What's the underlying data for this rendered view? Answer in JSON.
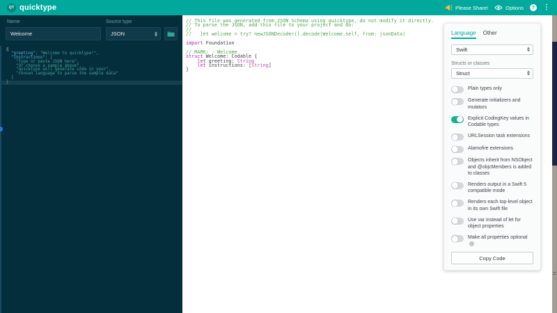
{
  "colors": {
    "header_bar": "#00a99c",
    "left_panel_bg": "#052e3d",
    "accent_teal": "#00a99c",
    "toggle_on": "#10b397",
    "comment_green": "#4ca64c",
    "keyword_magenta": "#ad28a2",
    "json_key_blue": "#58b0d4",
    "json_string_teal": "#45a491"
  },
  "header": {
    "logo_text": "QT",
    "app_name": "quicktype",
    "share_label": "Please Share!",
    "options_label": "Options",
    "help_label": "?",
    "menu_icon": "vertical-dots"
  },
  "left_panel": {
    "name_label": "Name",
    "name_value": "Welcome",
    "source_type_label": "Source type",
    "source_type_value": "JSON",
    "json_lines": [
      {
        "segs": [
          {
            "c": "jp hl",
            "t": "{"
          }
        ]
      },
      {
        "segs": [
          {
            "c": "jp",
            "t": "  "
          },
          {
            "c": "jk",
            "t": "\"greeting\""
          },
          {
            "c": "jp",
            "t": ": "
          },
          {
            "c": "js",
            "t": "\"Welcome to quicktype!\""
          },
          {
            "c": "jp",
            "t": ","
          }
        ]
      },
      {
        "segs": [
          {
            "c": "jp",
            "t": "  "
          },
          {
            "c": "jk",
            "t": "\"instructions\""
          },
          {
            "c": "jp",
            "t": ": ["
          }
        ]
      },
      {
        "segs": [
          {
            "c": "jp",
            "t": "    "
          },
          {
            "c": "js",
            "t": "\"Type or paste JSON here\""
          },
          {
            "c": "jp",
            "t": ","
          }
        ]
      },
      {
        "segs": [
          {
            "c": "jp",
            "t": "    "
          },
          {
            "c": "js",
            "t": "\"Or choose a sample above\""
          },
          {
            "c": "jp",
            "t": ","
          }
        ]
      },
      {
        "segs": [
          {
            "c": "jp",
            "t": "    "
          },
          {
            "c": "js",
            "t": "\"quicktype will generate code in your\""
          },
          {
            "c": "jp",
            "t": ","
          }
        ]
      },
      {
        "segs": [
          {
            "c": "jp",
            "t": "    "
          },
          {
            "c": "js",
            "t": "\"chosen language to parse the sample data\""
          }
        ]
      },
      {
        "segs": [
          {
            "c": "jp",
            "t": "  ]"
          }
        ]
      },
      {
        "segs": [
          {
            "c": "jp",
            "t": "}"
          }
        ],
        "active": true
      }
    ]
  },
  "code_editor": {
    "language": "Swift",
    "lines": [
      {
        "segs": [
          {
            "c": "cm",
            "t": "// This file was generated from JSON Schema using quicktype, do not modify it directly."
          }
        ]
      },
      {
        "segs": [
          {
            "c": "cm",
            "t": "// To parse the JSON, add this file to your project and do:"
          }
        ]
      },
      {
        "segs": [
          {
            "c": "cm",
            "t": "//"
          }
        ]
      },
      {
        "segs": [
          {
            "c": "cm",
            "t": "//   let welcome = try? newJSONDecoder().decode(Welcome.self, from: jsonData)"
          }
        ]
      },
      {
        "segs": []
      },
      {
        "segs": [
          {
            "c": "kw",
            "t": "import"
          },
          {
            "c": "pl",
            "t": " Foundation"
          }
        ]
      },
      {
        "segs": []
      },
      {
        "segs": [
          {
            "c": "cm",
            "t": "// MARK: - Welcome"
          }
        ]
      },
      {
        "segs": [
          {
            "c": "kw",
            "t": "struct"
          },
          {
            "c": "pl",
            "t": " Welcome: Codable {"
          }
        ]
      },
      {
        "segs": [
          {
            "c": "pl",
            "t": "    "
          },
          {
            "c": "kw",
            "t": "let"
          },
          {
            "c": "pl",
            "t": " greeting: "
          },
          {
            "c": "ty",
            "t": "String"
          }
        ]
      },
      {
        "segs": [
          {
            "c": "pl",
            "t": "    "
          },
          {
            "c": "kw",
            "t": "let"
          },
          {
            "c": "pl",
            "t": " instructions: ["
          },
          {
            "c": "ty",
            "t": "String"
          },
          {
            "c": "pl",
            "t": "]"
          }
        ]
      },
      {
        "segs": [
          {
            "c": "pl",
            "t": "}"
          }
        ]
      }
    ]
  },
  "options_panel": {
    "tabs": [
      {
        "label": "Language",
        "active": true
      },
      {
        "label": "Other",
        "active": false
      }
    ],
    "language_value": "Swift",
    "structs_label": "Structs or classes",
    "structs_value": "Struct",
    "toggles": [
      {
        "label": "Plain types only",
        "on": false
      },
      {
        "label": "Generate initializers and mutators",
        "on": false
      },
      {
        "label": "Explicit CodingKey values in Codable types",
        "on": true
      },
      {
        "label": "URLSession task extensions",
        "on": false
      },
      {
        "label": "Alamofire extensions",
        "on": false
      },
      {
        "label": "Objects inherit from NSObject and @objcMembers is added to classes",
        "on": false
      },
      {
        "label": "Renders output in a Swift 5 compatible mode",
        "on": false
      },
      {
        "label": "Renders each top-level object in its own Swift file",
        "on": false
      },
      {
        "label": "Use var instead of let for object properties",
        "on": false
      },
      {
        "label": "Make all properties optional",
        "on": false,
        "info": true
      }
    ],
    "copy_button_label": "Copy Code"
  }
}
